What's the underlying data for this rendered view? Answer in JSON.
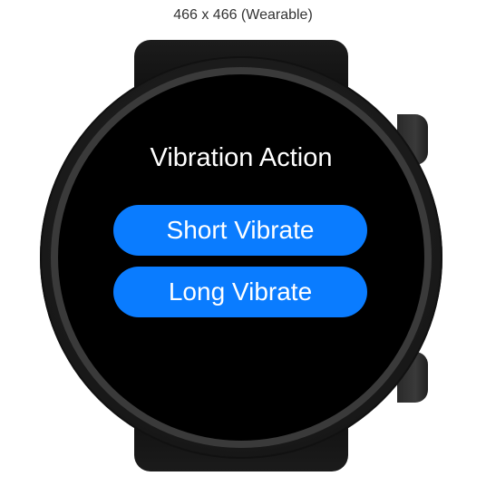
{
  "device_label": "466 x 466 (Wearable)",
  "screen": {
    "title": "Vibration Action",
    "buttons": {
      "short_vibrate": "Short Vibrate",
      "long_vibrate": "Long Vibrate"
    }
  },
  "colors": {
    "button_background": "#0a7cff",
    "screen_background": "#000000",
    "text": "#ffffff"
  }
}
